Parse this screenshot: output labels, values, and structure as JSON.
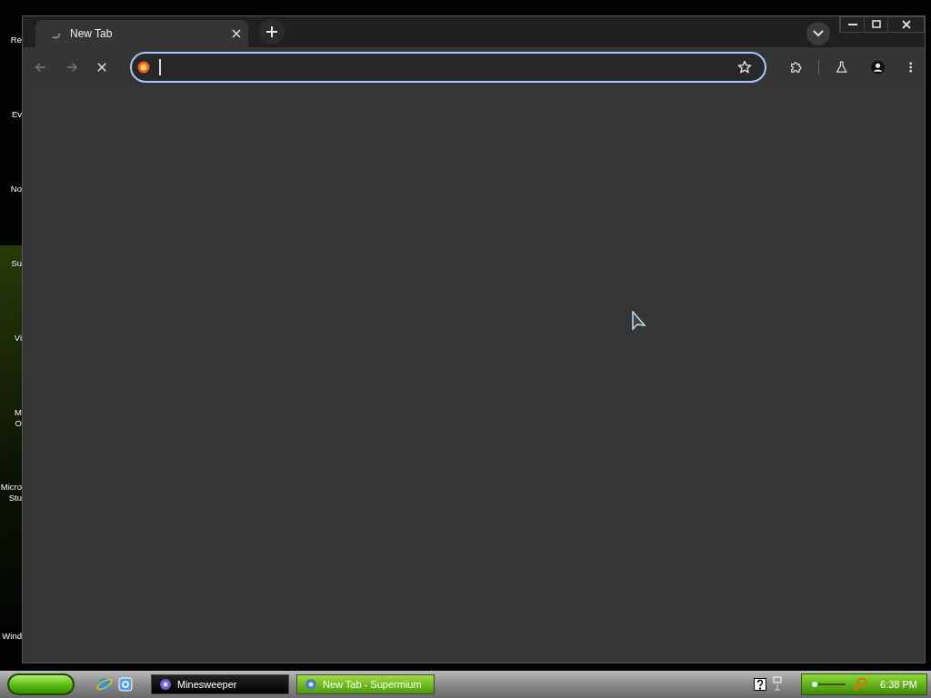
{
  "desktop": {
    "icons": [
      {
        "lines": [
          "Re"
        ]
      },
      {
        "lines": [
          "Ev"
        ]
      },
      {
        "lines": [
          "No"
        ]
      },
      {
        "lines": [
          "Su"
        ]
      },
      {
        "lines": [
          "Vi"
        ]
      },
      {
        "lines": [
          "M",
          "O"
        ]
      },
      {
        "lines": [
          "Micro",
          "Stu"
        ]
      },
      {
        "lines": [
          "Wind"
        ]
      }
    ]
  },
  "browser": {
    "tabs": [
      {
        "title": "New Tab",
        "selected": true
      }
    ]
  },
  "taskbar": {
    "tasks": [
      {
        "label": "Minesweeper",
        "selected": false
      },
      {
        "label": "New Tab - Supermium",
        "selected": true
      }
    ],
    "clock": "6:38 PM"
  }
}
